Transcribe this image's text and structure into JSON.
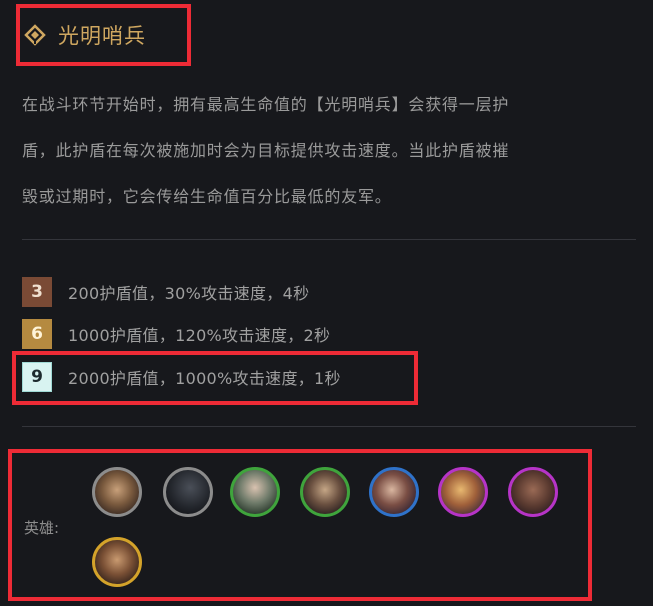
{
  "trait": {
    "name": "光明哨兵",
    "icon": "trait-diamond-icon",
    "description": [
      "在战斗环节开始时，拥有最高生命值的【光明哨兵】会获得一层护",
      "盾，此护盾在每次被施加时会为目标提供攻击速度。当此护盾被摧",
      "毁或过期时，它会传给生命值百分比最低的友军。"
    ]
  },
  "tiers": [
    {
      "count": "3",
      "text": "200护盾值，30%攻击速度，4秒",
      "color": "#7a4a35"
    },
    {
      "count": "6",
      "text": "1000护盾值，120%攻击速度，2秒",
      "color": "#b58a40"
    },
    {
      "count": "9",
      "text": "2000护盾值，1000%攻击速度，1秒",
      "color": "#d8f3f1"
    }
  ],
  "champions": {
    "label": "英雄:",
    "items": [
      {
        "name": "champion-1",
        "border": "#8c8c8c"
      },
      {
        "name": "champion-2",
        "border": "#8c8c8c"
      },
      {
        "name": "champion-3",
        "border": "#3fa43c"
      },
      {
        "name": "champion-4",
        "border": "#3fa43c"
      },
      {
        "name": "champion-5",
        "border": "#2f72c9"
      },
      {
        "name": "champion-6",
        "border": "#b634c7"
      },
      {
        "name": "champion-7",
        "border": "#b634c7"
      },
      {
        "name": "champion-8",
        "border": "#d4a32a"
      }
    ]
  },
  "colors": {
    "highlight": "#ee2b36",
    "title": "#cfa760"
  }
}
